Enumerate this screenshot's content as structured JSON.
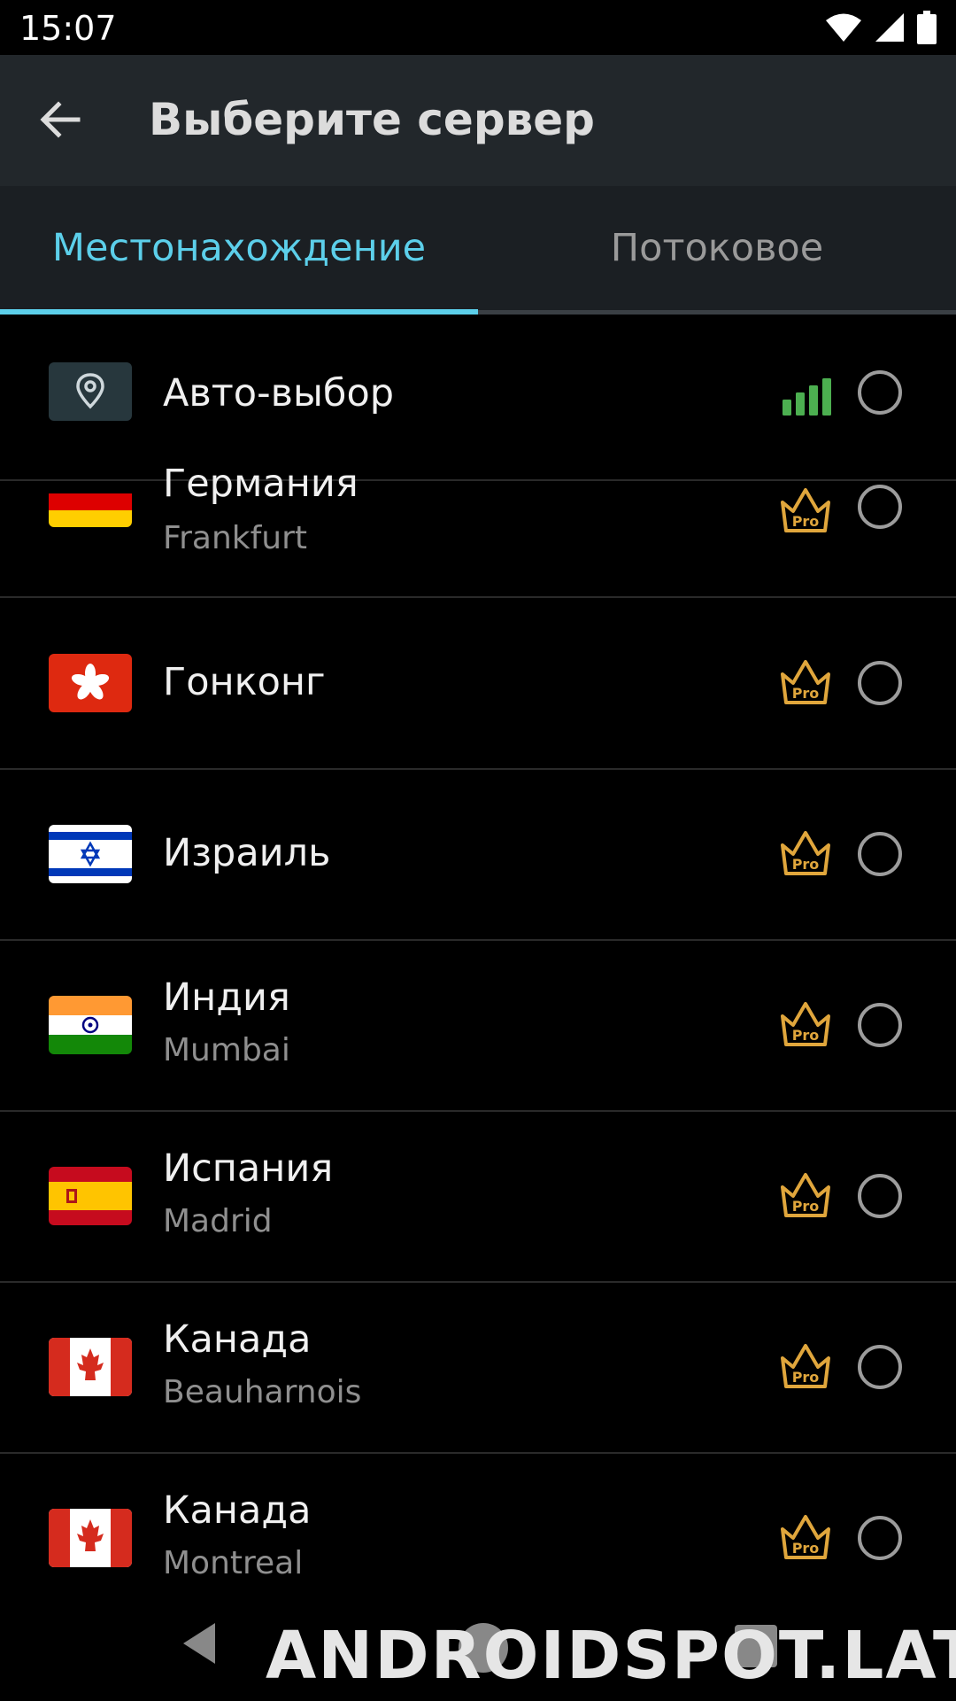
{
  "status_bar": {
    "time": "15:07",
    "icons": [
      "wifi-icon",
      "cell-signal-icon",
      "battery-icon"
    ]
  },
  "app_bar": {
    "title": "Выберите сервер",
    "back_icon": "arrow-left-icon"
  },
  "tabs": [
    {
      "label": "Местонахождение",
      "selected": true
    },
    {
      "label": "Потоковое",
      "selected": false
    }
  ],
  "auto_select": {
    "label": "Авто-выбор",
    "icon": "location-pin-icon",
    "signal_color": "#4caf50"
  },
  "servers": [
    {
      "country": "Германия",
      "city": "Frankfurt",
      "flag": "germany-flag",
      "pro": "Pro"
    },
    {
      "country": "Гонконг",
      "city": "",
      "flag": "hong-kong-flag",
      "pro": "Pro"
    },
    {
      "country": "Израиль",
      "city": "",
      "flag": "israel-flag",
      "pro": "Pro"
    },
    {
      "country": "Индия",
      "city": "Mumbai",
      "flag": "india-flag",
      "pro": "Pro"
    },
    {
      "country": "Испания",
      "city": "Madrid",
      "flag": "spain-flag",
      "pro": "Pro"
    },
    {
      "country": "Канада",
      "city": "Beauharnois",
      "flag": "canada-flag",
      "pro": "Pro"
    },
    {
      "country": "Канада",
      "city": "Montreal",
      "flag": "canada-flag",
      "pro": "Pro"
    }
  ],
  "watermark": "ANDROIDSPOT.LAT",
  "colors": {
    "accent": "#5ccfea",
    "pro_gold": "#e0a63c",
    "background": "#000000",
    "app_bar": "#22272b"
  }
}
